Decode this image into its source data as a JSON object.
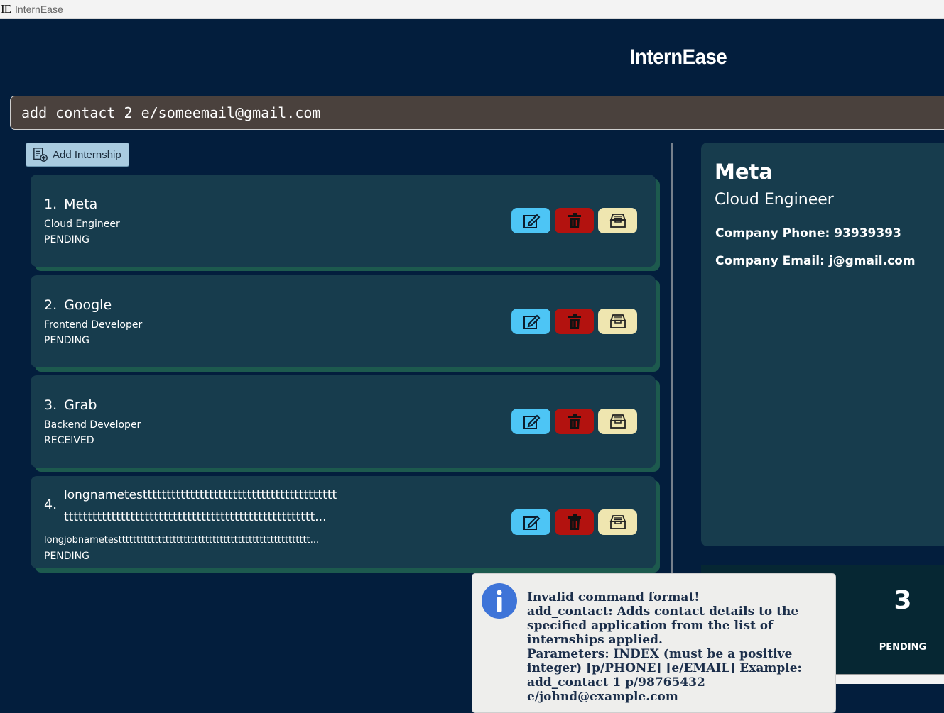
{
  "window": {
    "icon_text": "IE",
    "title": "InternEase"
  },
  "header": {
    "app_name": "InternEase"
  },
  "command": {
    "value": "add_contact 2 e/someemail@gmail.com"
  },
  "toolbar": {
    "add_label": "Add Internship"
  },
  "internships": [
    {
      "index": "1.",
      "company": "Meta",
      "role": "Cloud Engineer",
      "status": "PENDING"
    },
    {
      "index": "2.",
      "company": "Google",
      "role": "Frontend Developer",
      "status": "PENDING"
    },
    {
      "index": "3.",
      "company": "Grab",
      "role": "Backend Developer",
      "status": "RECEIVED"
    },
    {
      "index": "4.",
      "company_line1": "longnametesttttttttttttttttttttttttttttttttttttttttt",
      "company_line2": "ttttttttttttttttttttttttttttttttttttttttttttttttttttt...",
      "role": "longjobnametesttttttttttttttttttttttttttttttttttttttttttttttttttttt...",
      "status": "PENDING"
    }
  ],
  "detail": {
    "company": "Meta",
    "role": "Cloud Engineer",
    "phone_line": "Company Phone: 93939393",
    "email_line": "Company Email: j@gmail.com"
  },
  "stats": {
    "count": "3",
    "label": "PENDING"
  },
  "popup": {
    "message": "Invalid command format!\nadd_contact: Adds contact details to the\nspecified application from the list of\ninternships applied.\nParameters: INDEX (must be a positive\ninteger) [p/PHONE] [e/EMAIL] Example:\nadd_contact 1 p/98765432\ne/johnd@example.com"
  },
  "colors": {
    "background": "#031e3d",
    "card": "#173c4d",
    "edit": "#4dc5f5",
    "delete": "#b3120f",
    "archive": "#efe6b0",
    "command_bg": "#4a413d"
  }
}
